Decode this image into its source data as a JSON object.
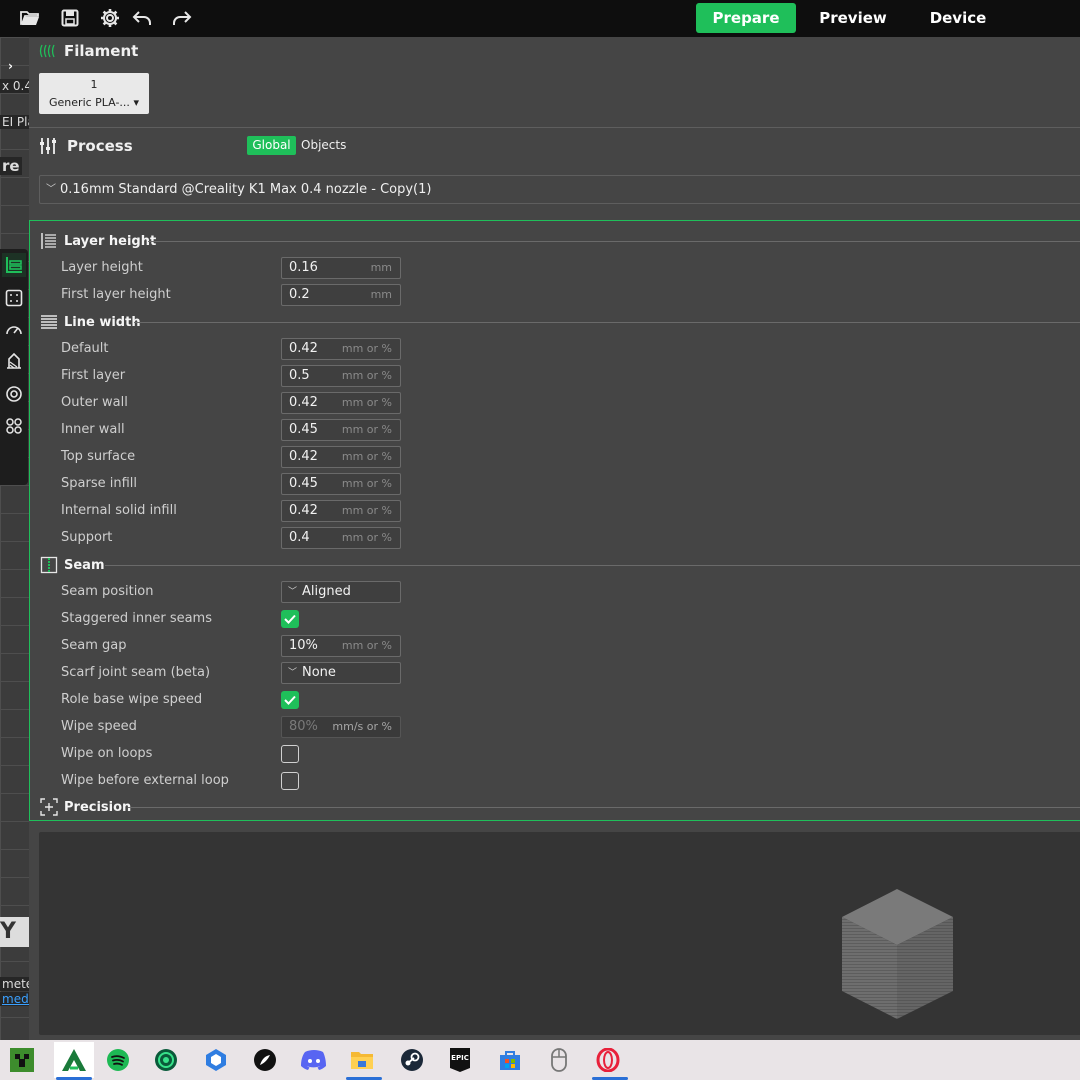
{
  "topbar": {
    "tabs": [
      {
        "label": "Prepare",
        "active": true
      },
      {
        "label": "Preview",
        "active": false
      },
      {
        "label": "Device",
        "active": false
      }
    ],
    "icons": [
      "folder-open-icon",
      "save-icon",
      "gear-icon",
      "undo-icon",
      "redo-icon"
    ],
    "accent": "#1fbf5a"
  },
  "leftstrip": {
    "fragments": [
      "x 0.4",
      "EI Pla",
      "re",
      "mete",
      "media"
    ]
  },
  "filament": {
    "title": "Filament",
    "slot_number": "1",
    "slot_name": "Generic PLA-..."
  },
  "process": {
    "title": "Process",
    "tab_global": "Global",
    "tab_objects": "Objects",
    "preset": "0.16mm Standard @Creality K1 Max 0.4 nozzle - Copy(1)"
  },
  "groups": {
    "layer_height": "Layer height",
    "line_width": "Line width",
    "seam": "Seam",
    "precision": "Precision"
  },
  "layer_height": [
    {
      "label": "Layer height",
      "value": "0.16",
      "unit": "mm"
    },
    {
      "label": "First layer height",
      "value": "0.2",
      "unit": "mm"
    }
  ],
  "line_width": [
    {
      "label": "Default",
      "value": "0.42",
      "unit": "mm or %"
    },
    {
      "label": "First layer",
      "value": "0.5",
      "unit": "mm or %"
    },
    {
      "label": "Outer wall",
      "value": "0.42",
      "unit": "mm or %"
    },
    {
      "label": "Inner wall",
      "value": "0.45",
      "unit": "mm or %"
    },
    {
      "label": "Top surface",
      "value": "0.42",
      "unit": "mm or %"
    },
    {
      "label": "Sparse infill",
      "value": "0.45",
      "unit": "mm or %"
    },
    {
      "label": "Internal solid infill",
      "value": "0.42",
      "unit": "mm or %"
    },
    {
      "label": "Support",
      "value": "0.4",
      "unit": "mm or %"
    }
  ],
  "seam": {
    "seam_position": {
      "label": "Seam position",
      "value": "Aligned"
    },
    "staggered": {
      "label": "Staggered inner seams",
      "checked": true
    },
    "seam_gap": {
      "label": "Seam gap",
      "value": "10%",
      "unit": "mm or %"
    },
    "scarf": {
      "label": "Scarf joint seam (beta)",
      "value": "None"
    },
    "role_wipe": {
      "label": "Role base wipe speed",
      "checked": true
    },
    "wipe_speed": {
      "label": "Wipe speed",
      "value": "80%",
      "unit": "mm/s or %"
    },
    "wipe_loops": {
      "label": "Wipe on loops",
      "checked": false
    },
    "wipe_before": {
      "label": "Wipe before external loop",
      "checked": false
    }
  },
  "taskbar": {
    "apps": [
      "minecraft-icon",
      "creality-print-icon",
      "spotify-icon",
      "app-icon",
      "app-icon",
      "app-icon",
      "discord-icon",
      "file-explorer-icon",
      "steam-icon",
      "epic-games-icon",
      "store-icon",
      "mouse-icon",
      "opera-icon"
    ]
  }
}
